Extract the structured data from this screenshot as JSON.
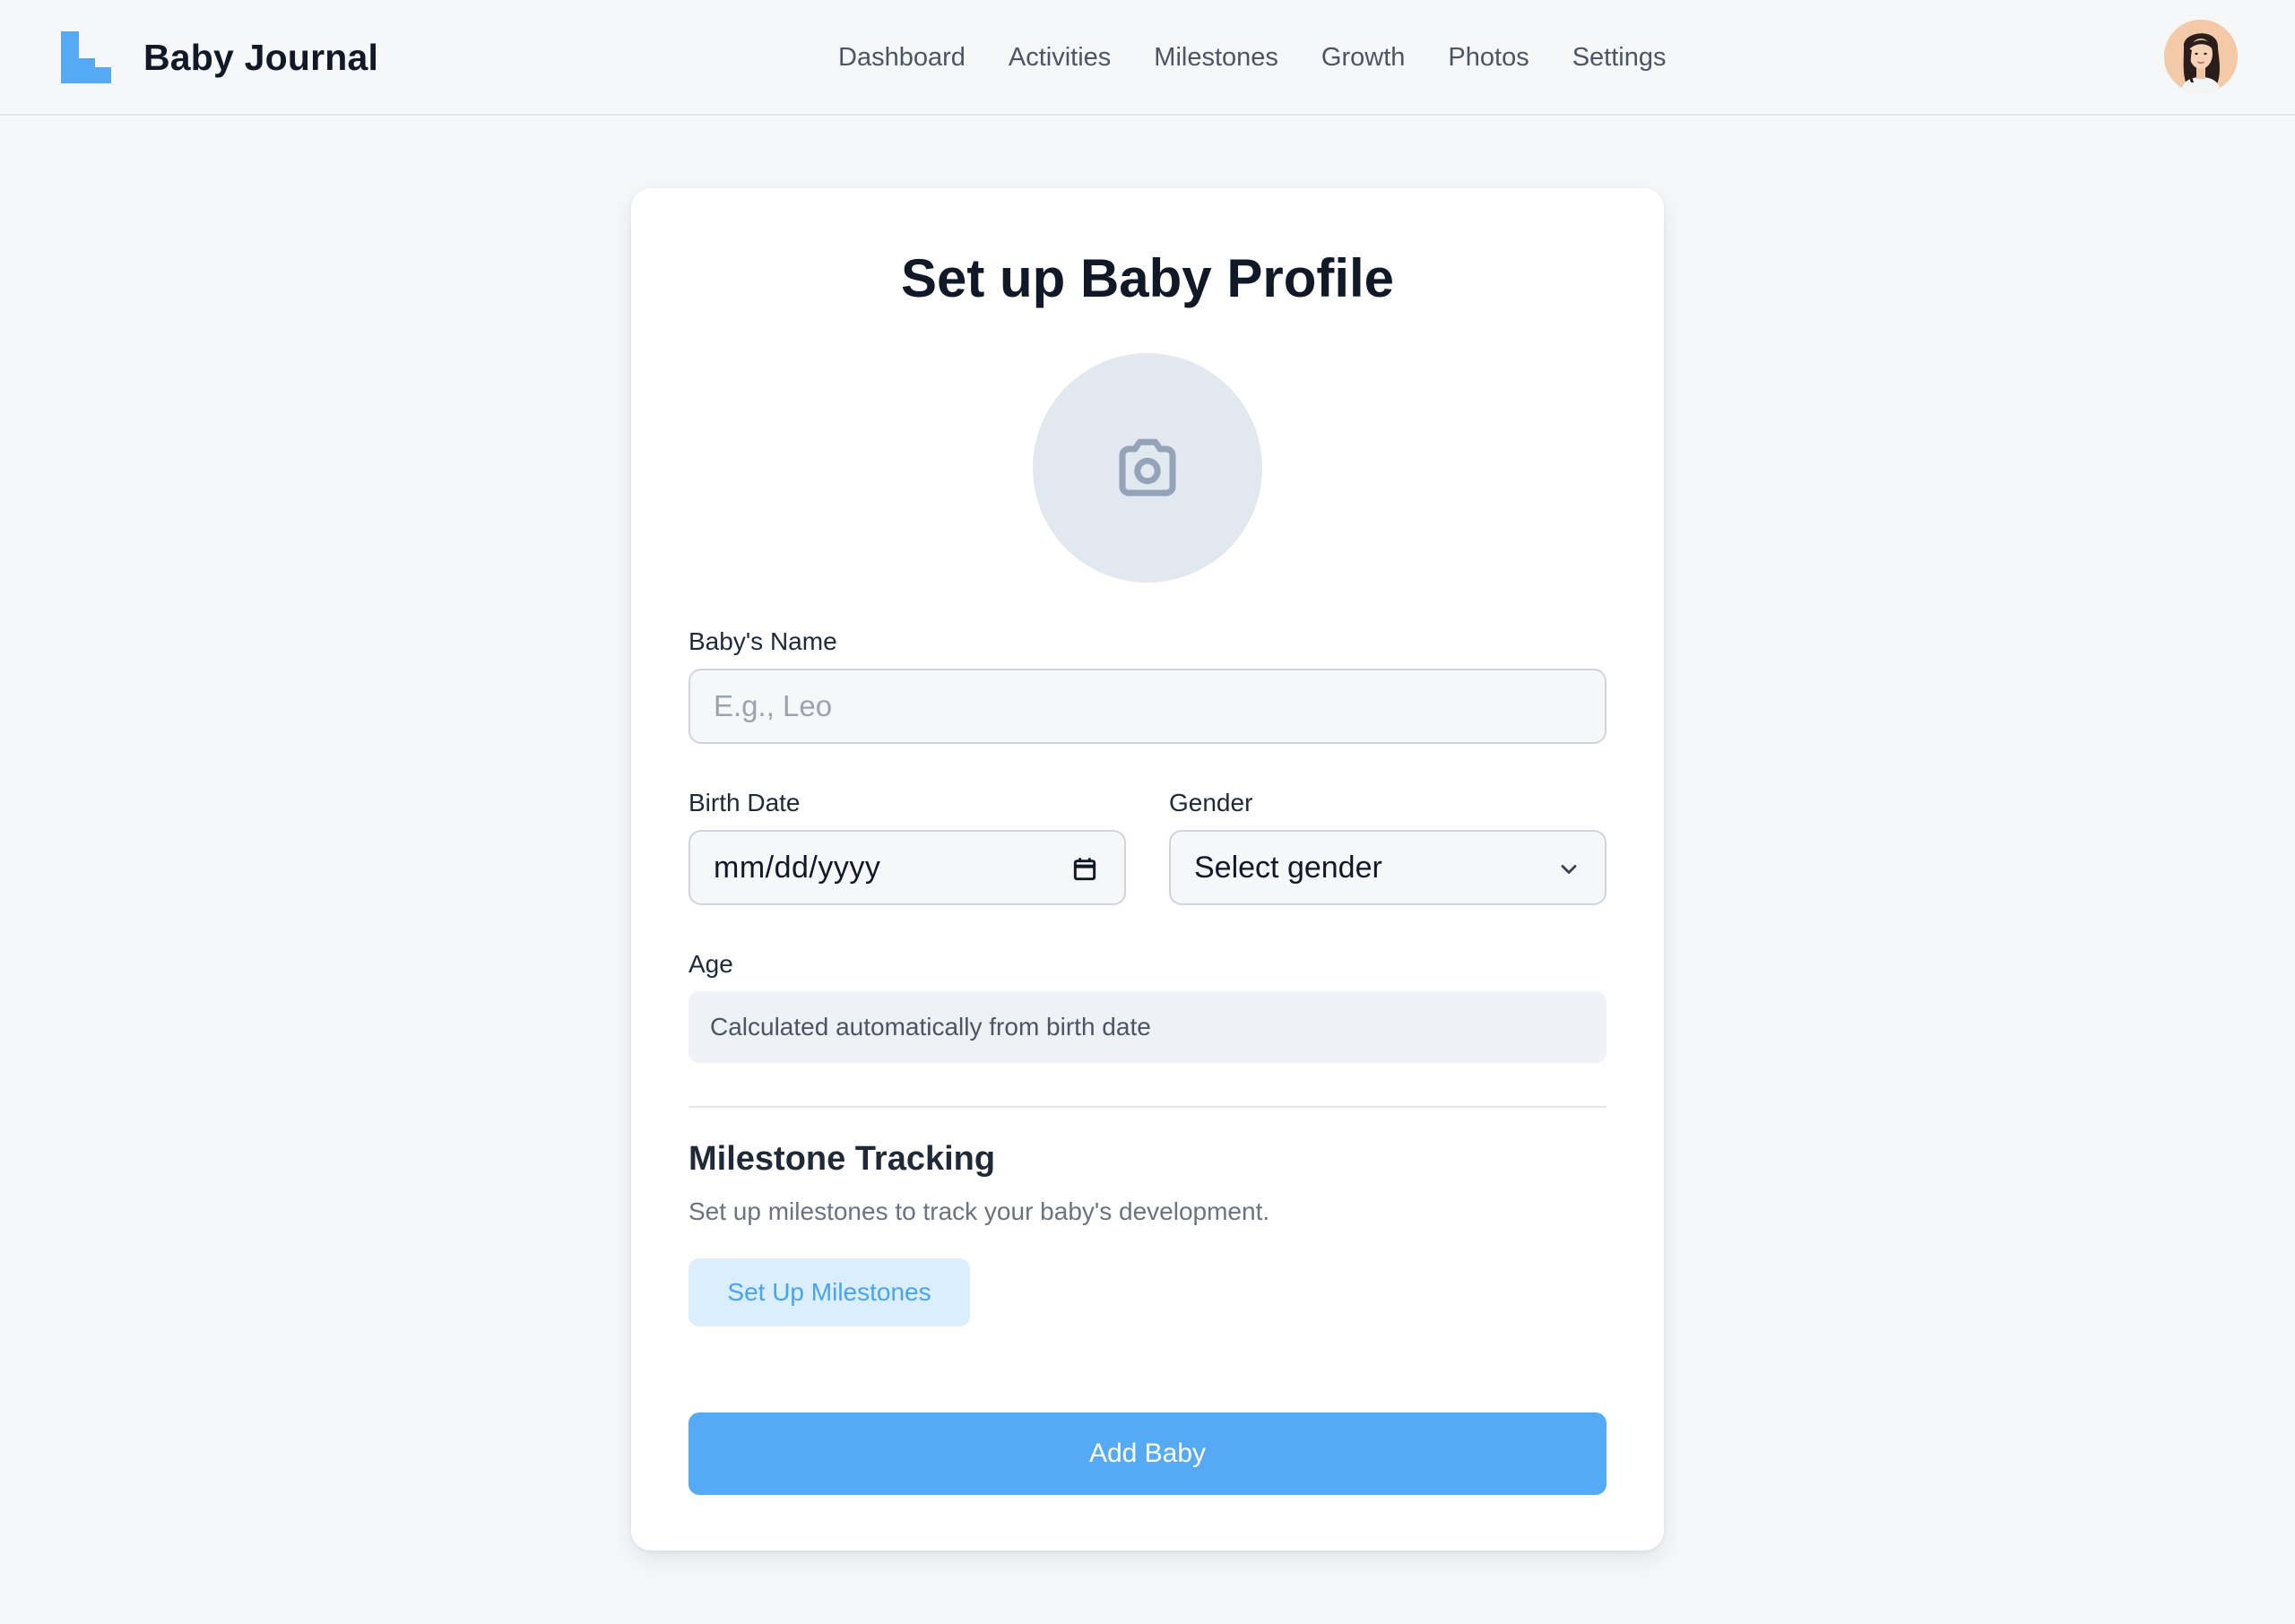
{
  "app": {
    "name": "Baby Journal"
  },
  "nav": {
    "items": [
      {
        "label": "Dashboard"
      },
      {
        "label": "Activities"
      },
      {
        "label": "Milestones"
      },
      {
        "label": "Growth"
      },
      {
        "label": "Photos"
      },
      {
        "label": "Settings"
      }
    ]
  },
  "user": {
    "avatar_icon": "user-avatar"
  },
  "form": {
    "title": "Set up Baby Profile",
    "photo_icon": "camera-icon",
    "name": {
      "label": "Baby's Name",
      "placeholder": "E.g., Leo",
      "value": ""
    },
    "birth_date": {
      "label": "Birth Date",
      "value": "mm/dd/yyyy",
      "icon": "calendar-icon"
    },
    "gender": {
      "label": "Gender",
      "selected": "Select gender",
      "icon": "chevron-down-icon"
    },
    "age": {
      "label": "Age",
      "value": "Calculated automatically from birth date"
    },
    "milestones": {
      "title": "Milestone Tracking",
      "description": "Set up milestones to track your baby's development.",
      "button_label": "Set Up Milestones"
    },
    "submit_label": "Add Baby"
  },
  "colors": {
    "accent": "#56aaf5",
    "accent_light": "#dbeefe",
    "accent_text": "#48a3f5",
    "logo": "#56aaf5",
    "background": "#f5f7f9",
    "card": "#ffffff",
    "photo_circle": "#e2e8f0",
    "icon_gray": "#94a3b8"
  }
}
